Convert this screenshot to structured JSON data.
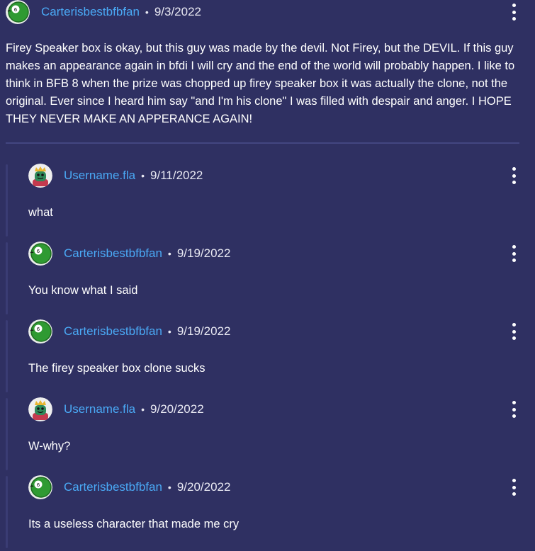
{
  "top_comment": {
    "username": "Carterisbestbfbfan",
    "date": "9/3/2022",
    "avatar": "green-ball-6-avatar",
    "body": "Firey Speaker box is okay, but this guy was made by the devil. Not Firey, but the DEVIL. If this guy makes an appearance again in bfdi I will cry and the end of the world will probably happen.  I like to think in BFB 8 when the prize was chopped up firey speaker box it was actually the clone, not the original.  Ever since I heard him say \"and I'm his clone\" I was filled with despair and anger. I HOPE THEY NEVER MAKE AN APPERANCE AGAIN!"
  },
  "replies": [
    {
      "username": "Username.fla",
      "date": "9/11/2022",
      "avatar": "crowned-character-avatar",
      "body": "what"
    },
    {
      "username": "Carterisbestbfbfan",
      "date": "9/19/2022",
      "avatar": "green-ball-6-avatar",
      "body": "You know what I said"
    },
    {
      "username": "Carterisbestbfbfan",
      "date": "9/19/2022",
      "avatar": "green-ball-6-avatar",
      "body": "The firey speaker box clone sucks"
    },
    {
      "username": "Username.fla",
      "date": "9/20/2022",
      "avatar": "crowned-character-avatar",
      "body": "W-why?"
    },
    {
      "username": "Carterisbestbfbfan",
      "date": "9/20/2022",
      "avatar": "green-ball-6-avatar",
      "body": "Its a useless character that made me cry"
    }
  ],
  "separator_glyph": "•",
  "colors": {
    "background": "#2f3062",
    "username": "#4aa9f5",
    "text": "#ffffff",
    "separator": "#434681"
  }
}
